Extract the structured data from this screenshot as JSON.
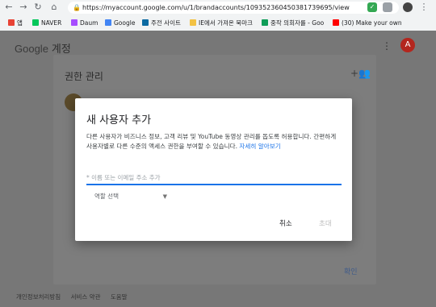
{
  "browser": {
    "url": "https://myaccount.google.com/u/1/brandaccounts/109352360450381739695/view",
    "bookmarks": [
      {
        "label": "앱",
        "color": "#e84335"
      },
      {
        "label": "NAVER",
        "color": "#03c75a"
      },
      {
        "label": "Daum",
        "color": "#a64dff"
      },
      {
        "label": "Google",
        "color": "#4285f4"
      },
      {
        "label": "주전 사이트",
        "color": "#0b6aa2"
      },
      {
        "label": "IE에서 가져온 북마크",
        "color": "#f3c244"
      },
      {
        "label": "중작 의회자를 - Goo",
        "color": "#0f9d58"
      },
      {
        "label": "(30) Make your own",
        "color": "#ff0000"
      }
    ]
  },
  "header": {
    "logo": "Google",
    "account_label": "계정",
    "menu_icon": "⋮",
    "avatar_letter": "A"
  },
  "card": {
    "title": "권한 관리",
    "confirm_label": "확인"
  },
  "footer": {
    "links": [
      "개인정보처리방침",
      "서비스 약관",
      "도움말"
    ]
  },
  "dialog": {
    "title": "새 사용자 추가",
    "description": "다른 사용자가 비즈니스 정보, 고객 리뷰 및 YouTube 동영상 관리를 돕도록 허용합니다. 간편하게 사용자별로 다른 수준의 액세스 권한을 부여할 수 있습니다.",
    "learn_more": "자세히 알아보기",
    "input_placeholder": "* 이름 또는 이메일 주소 추가",
    "role_label": "역할 선택",
    "cancel_label": "취소",
    "invite_label": "초대"
  }
}
